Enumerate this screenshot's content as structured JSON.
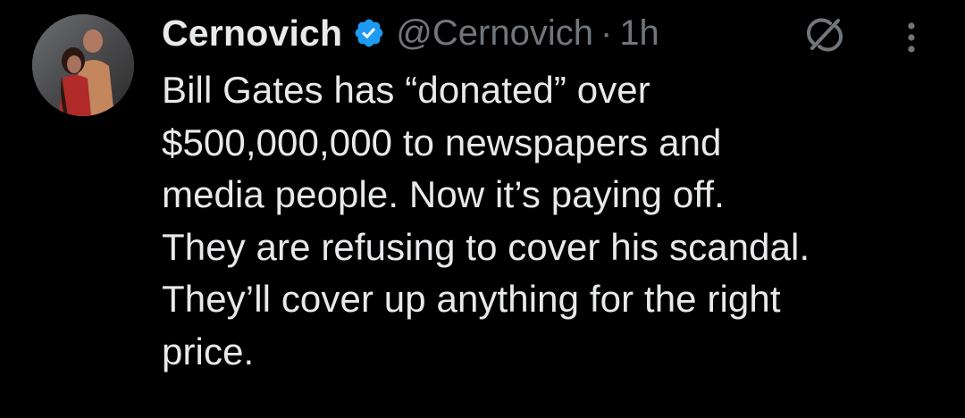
{
  "author": {
    "display_name": "Cernovich",
    "handle": "@Cernovich",
    "separator": "·",
    "timestamp": "1h",
    "verified": true,
    "avatar_icon": "profile-photo"
  },
  "icons": {
    "verified": "verified-badge-icon",
    "grok": "grok-icon",
    "more": "more-options-icon"
  },
  "colors": {
    "background": "#000000",
    "text_primary": "#e7e9ea",
    "text_secondary": "#71767b",
    "verified_blue": "#1d9bf0"
  },
  "tweet": {
    "text": "Bill Gates has “donated” over\n$500,000,000 to newspapers and\nmedia people. Now it’s paying off.\nThey are refusing to cover his scandal.\nThey’ll cover up anything for the right\nprice."
  }
}
